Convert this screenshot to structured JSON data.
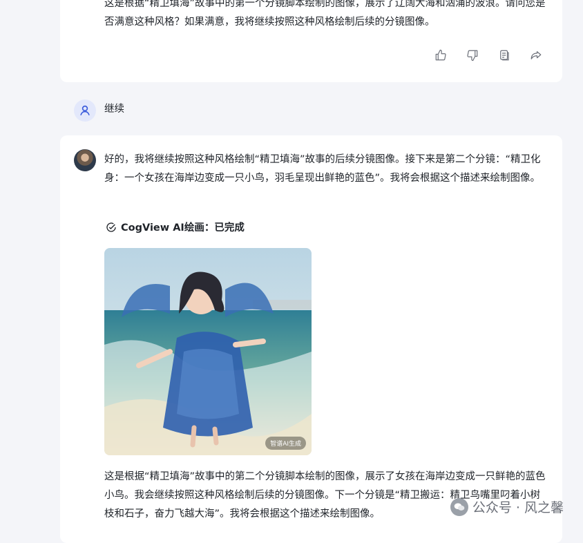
{
  "messages": {
    "assistant_1_text": "这是根据“精卫填海”故事中的第一个分镜脚本绘制的图像，展示了辽阔大海和汹涌的波浪。请问您是否满意这种风格？如果满意，我将继续按照这种风格绘制后续的分镜图像。",
    "user_text": "继续",
    "assistant_2_text": "好的，我将继续按照这种风格绘制“精卫填海”故事的后续分镜图像。接下来是第二个分镜：“精卫化身：一个女孩在海岸边变成一只小鸟，羽毛呈现出鲜艳的蓝色”。我将会根据这个描述来绘制图像。",
    "status_text": "CogView AI绘画：已完成",
    "image_badge": "智谱AI生成",
    "assistant_3_text": "这是根据“精卫填海”故事中的第二个分镜脚本绘制的图像，展示了女孩在海岸边变成一只鲜艳的蓝色小鸟。我会继续按照这种风格绘制后续的分镜图像。下一个分镜是“精卫搬运：精卫鸟嘴里叼着小树枝和石子，奋力飞越大海”。我将会根据这个描述来绘制图像。"
  },
  "actions": [
    "thumbs-up-icon",
    "thumbs-down-icon",
    "copy-icon",
    "share-icon"
  ],
  "watermark": {
    "text": "公众号 · 风之馨"
  },
  "colors": {
    "background": "#f4f5f9",
    "card": "#ffffff",
    "user_avatar_bg": "#e3e8fb",
    "user_avatar_icon": "#3b5bdb"
  }
}
